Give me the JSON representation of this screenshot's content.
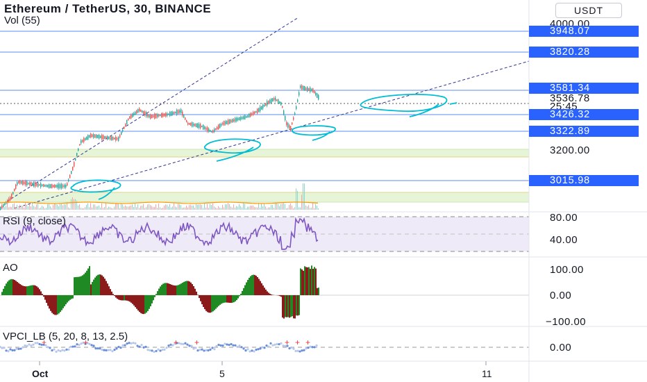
{
  "header": {
    "title": "Ethereum / TetherUS, 30, BINANCE",
    "volume_label": "Vol (55)",
    "currency": "USDT"
  },
  "price_axis": {
    "labels": [
      "4000.00",
      "3200.00",
      "3536.78",
      "25:45"
    ],
    "tags": [
      "3948.07",
      "3820.28",
      "3581.34",
      "3426.32",
      "3322.89",
      "3015.98"
    ],
    "tag_color": "#2962ff"
  },
  "panes": {
    "rsi": {
      "label": "RSI (9, close)",
      "axis": [
        "80.00",
        "40.00"
      ]
    },
    "ao": {
      "label": "AO",
      "axis": [
        "100.00",
        "0.00",
        "−100.00"
      ]
    },
    "vpci": {
      "label": "VPCI_LB (5, 20, 8, 13, 2.5)",
      "axis": [
        "0.00"
      ]
    }
  },
  "time_axis": {
    "labels": [
      "Oct",
      "5",
      "11"
    ]
  },
  "colors": {
    "candle_up": "#26a69a",
    "candle_down": "#ef5350",
    "rsi_line": "#7e57c2",
    "ao_up": "#1f8a24",
    "ao_down": "#8b1a1a",
    "annotation": "#00bcd4",
    "horizontal_line": "#2962ff",
    "trend_line": "#2f3390"
  }
}
